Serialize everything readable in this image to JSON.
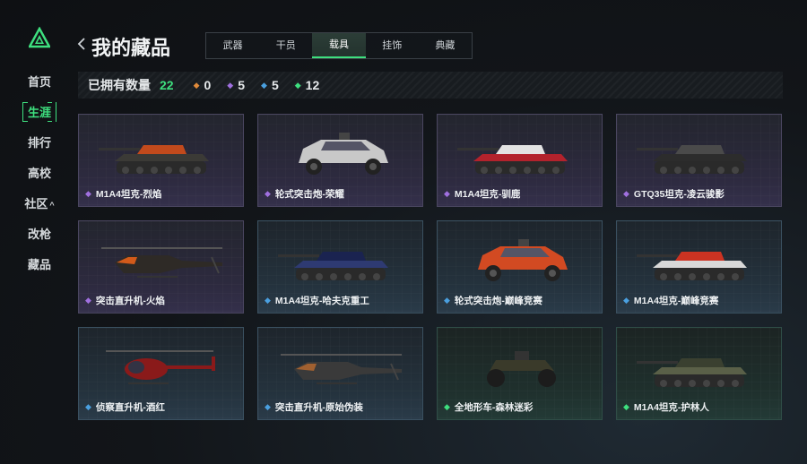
{
  "header": {
    "back_icon": "chevron-left-icon",
    "title": "我的藏品"
  },
  "sidebar": {
    "logo": "triangle-logo",
    "items": [
      {
        "label": "首页"
      },
      {
        "label": "生涯",
        "active": true
      },
      {
        "label": "排行"
      },
      {
        "label": "高校"
      },
      {
        "label": "社区",
        "caret": "^"
      },
      {
        "label": "改枪"
      },
      {
        "label": "藏品"
      }
    ]
  },
  "tabs": [
    {
      "label": "武器"
    },
    {
      "label": "干员"
    },
    {
      "label": "载具",
      "active": true
    },
    {
      "label": "挂饰"
    },
    {
      "label": "典藏"
    }
  ],
  "stats": {
    "owned_label": "已拥有数量",
    "owned_total": "22",
    "counts": [
      {
        "icon": "orange-diamond-icon",
        "value": "0"
      },
      {
        "icon": "purple-diamond-icon",
        "value": "5"
      },
      {
        "icon": "blue-diamond-icon",
        "value": "5"
      },
      {
        "icon": "green-diamond-icon",
        "value": "12"
      }
    ]
  },
  "colors": {
    "accent": "#3ee07f",
    "orange": "#e08a3a",
    "purple": "#a070e0",
    "blue": "#4aa0e0",
    "green": "#3ee07f"
  },
  "vehicles": [
    {
      "name": "M1A4坦克-烈焰",
      "rarity": "purple",
      "kind": "tank"
    },
    {
      "name": "轮式突击炮-荣耀",
      "rarity": "purple",
      "kind": "buggy"
    },
    {
      "name": "M1A4坦克-驯鹿",
      "rarity": "purple",
      "kind": "tank"
    },
    {
      "name": "GTQ35坦克-凌云骏影",
      "rarity": "purple",
      "kind": "tank"
    },
    {
      "name": "突击直升机-火焰",
      "rarity": "purple",
      "kind": "helicopter"
    },
    {
      "name": "M1A4坦克-哈夫克重工",
      "rarity": "blue",
      "kind": "tank"
    },
    {
      "name": "轮式突击炮-巅峰竞赛",
      "rarity": "blue",
      "kind": "buggy"
    },
    {
      "name": "M1A4坦克-巅峰竞赛",
      "rarity": "blue",
      "kind": "tank"
    },
    {
      "name": "侦察直升机-酒红",
      "rarity": "blue",
      "kind": "scout-helicopter"
    },
    {
      "name": "突击直升机-原始伪装",
      "rarity": "blue",
      "kind": "helicopter"
    },
    {
      "name": "全地形车-森林迷彩",
      "rarity": "green",
      "kind": "atv"
    },
    {
      "name": "M1A4坦克-护林人",
      "rarity": "green",
      "kind": "tank"
    }
  ]
}
